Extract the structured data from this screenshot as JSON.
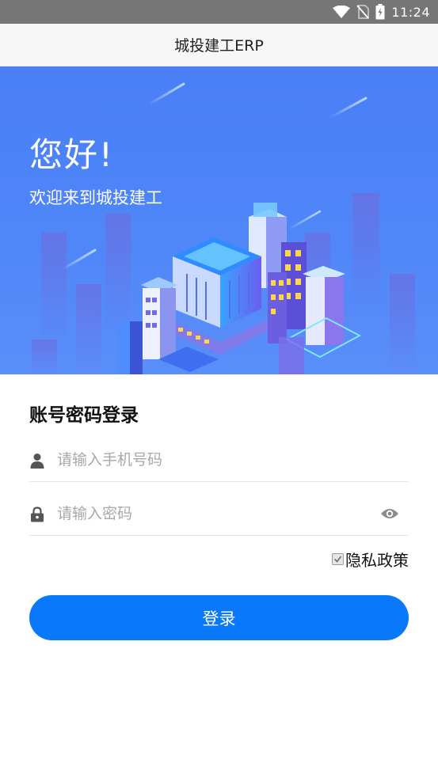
{
  "status_bar": {
    "time": "11:24",
    "icons": [
      "wifi-icon",
      "no-sim-icon",
      "battery-charging-icon"
    ]
  },
  "header": {
    "title": "城投建工ERP"
  },
  "banner": {
    "greeting": "您好!",
    "welcome": "欢迎来到城投建工",
    "illustration": "isometric-city-buildings"
  },
  "login": {
    "title": "账号密码登录",
    "phone": {
      "placeholder": "请输入手机号码",
      "value": "",
      "icon": "user-icon"
    },
    "password": {
      "placeholder": "请输入密码",
      "value": "",
      "icon": "lock-icon",
      "toggle_icon": "eye-icon"
    },
    "privacy": {
      "label": "隐私政策",
      "checked": true
    },
    "submit_label": "登录"
  },
  "colors": {
    "banner_blue": "#4f86f8",
    "button_blue": "#0a78fa",
    "status_bar": "#767676"
  }
}
